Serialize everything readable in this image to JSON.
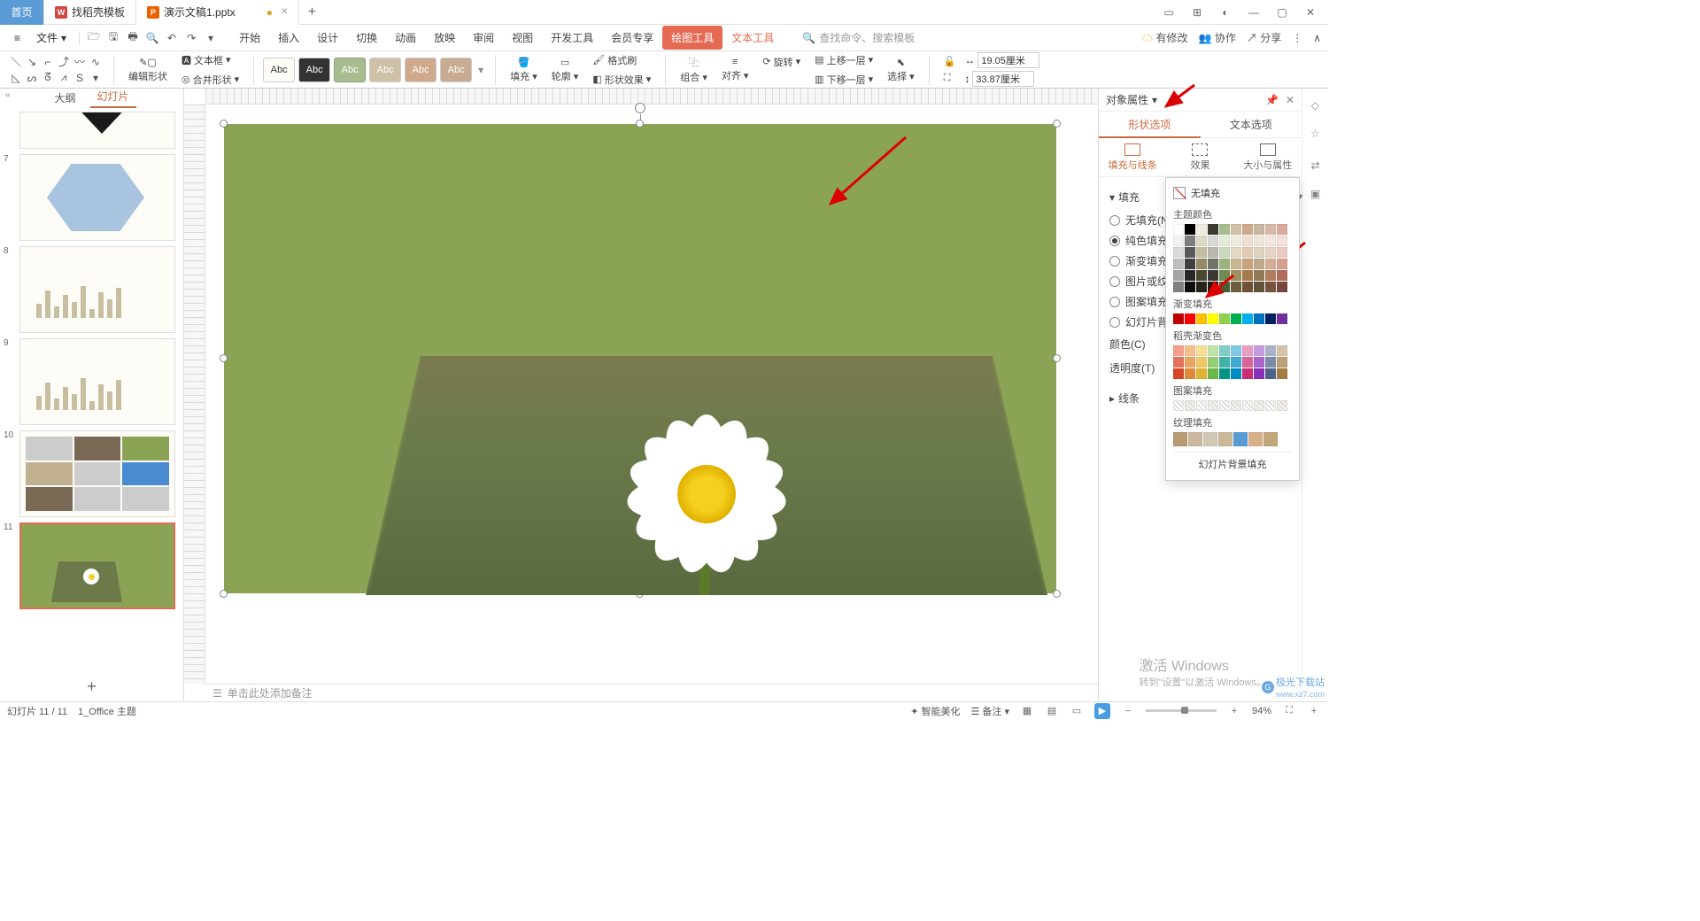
{
  "titlebar": {
    "home": "首页",
    "tab_template": "找稻壳模板",
    "tab_doc": "演示文稿1.pptx",
    "dirty_dot": "●",
    "plus": "+"
  },
  "menubar": {
    "file": "文件",
    "tabs": [
      "开始",
      "插入",
      "设计",
      "切换",
      "动画",
      "放映",
      "审阅",
      "视图",
      "开发工具",
      "会员专享"
    ],
    "draw_tool": "绘图工具",
    "text_tool": "文本工具",
    "search_placeholder": "查找命令、搜索模板",
    "pending": "有修改",
    "collab": "协作",
    "share": "分享"
  },
  "ribbon": {
    "edit_shape": "编辑形状",
    "textbox": "文本框",
    "merge_shape": "合并形状",
    "abc": "Abc",
    "fill": "填充",
    "outline": "轮廓",
    "shape_fx": "形状效果",
    "format_painter": "格式刷",
    "group": "组合",
    "align": "对齐",
    "rotate": "旋转",
    "bring_forward": "上移一层",
    "send_backward": "下移一层",
    "select": "选择",
    "width_icon": "↔",
    "height_icon": "↕",
    "width": "19.05厘米",
    "height": "33.87厘米"
  },
  "left": {
    "outline": "大纲",
    "slides": "幻灯片",
    "collapse": "«",
    "nums": [
      "7",
      "8",
      "9",
      "10",
      "11"
    ],
    "add": "+"
  },
  "canvas": {
    "notes_placeholder": "单击此处添加备注"
  },
  "panel": {
    "title": "对象属性",
    "shape_opts": "形状选项",
    "text_opts": "文本选项",
    "fill_line": "填充与线条",
    "effect": "效果",
    "size_prop": "大小与属性",
    "fill": "填充",
    "no_fill": "无填充(N)",
    "solid_fill": "纯色填充(S)",
    "gradient_fill": "渐变填充(G)",
    "pic_texture_fill": "图片或纹理填充(P)",
    "pattern_fill": "图案填充(A)",
    "slide_bg_fill": "幻灯片背景填充",
    "color": "颜色(C)",
    "opacity": "透明度(T)",
    "line": "线条"
  },
  "popup": {
    "no_fill": "无填充",
    "theme_colors": "主题颜色",
    "gradient_fill": "渐变填充",
    "dao_gradient": "稻壳渐变色",
    "pattern_fill": "图案填充",
    "texture_fill": "纹理填充",
    "slide_bg_fill": "幻灯片背景填充",
    "theme": {
      "row1": [
        "#ffffff",
        "#000000",
        "#efece1",
        "#3b3b34",
        "#a8bd8f",
        "#cfc1a8",
        "#d0a98c",
        "#c7b6a0",
        "#d6b9a8",
        "#dca9a0"
      ],
      "shades": [
        [
          "#f2f2f2",
          "#7f7f7f",
          "#ded9c5",
          "#d8d8d4",
          "#e5ebd9",
          "#f0ebdf",
          "#efe0d4",
          "#ece6da",
          "#f2e6df",
          "#f4e0dc"
        ],
        [
          "#d9d9d9",
          "#595959",
          "#c5bda0",
          "#b9b9b0",
          "#cdd9bc",
          "#e3d9c3",
          "#e1c9b2",
          "#dcd2bf",
          "#e7d2c4",
          "#ebcac2"
        ],
        [
          "#bfbfbf",
          "#404040",
          "#958c67",
          "#73736a",
          "#9ab57b",
          "#c7b690",
          "#caa37c",
          "#bdaa89",
          "#d3ae96",
          "#d59f91"
        ],
        [
          "#a6a6a6",
          "#262626",
          "#4b4630",
          "#3a3a33",
          "#6f8a52",
          "#a08f5f",
          "#a67a4f",
          "#8f7c57",
          "#b07d5e",
          "#b26e5c"
        ],
        [
          "#808080",
          "#0d0d0d",
          "#26231a",
          "#1d1d19",
          "#4a5d36",
          "#6b5f3f",
          "#6f5234",
          "#5f533a",
          "#76533e",
          "#77493d"
        ]
      ]
    },
    "bright": [
      "#c00000",
      "#ff0000",
      "#ffc000",
      "#ffff00",
      "#92d050",
      "#00b050",
      "#00b0f0",
      "#0070c0",
      "#002060",
      "#7030a0"
    ],
    "dao": {
      "row1": [
        "#f5a08c",
        "#f7bf8e",
        "#f7df95",
        "#bfe3a6",
        "#80cec7",
        "#80c8e6",
        "#e89ebf",
        "#c69be0",
        "#a9b3c7",
        "#d6c2a6"
      ],
      "row2": [
        "#e5735b",
        "#eaa562",
        "#ecc964",
        "#95ce77",
        "#40b1a6",
        "#40aad6",
        "#d9659b",
        "#a865ce",
        "#7c8ba9",
        "#bda073"
      ],
      "row3": [
        "#d64625",
        "#de8b36",
        "#e0b333",
        "#6cb948",
        "#009485",
        "#008cc5",
        "#cb2c77",
        "#8a2fbb",
        "#4f638c",
        "#a47e41"
      ]
    },
    "patterns": [
      "#ffffff",
      "#f6f3ea",
      "#ffffff",
      "#f6f3ea",
      "#ffffff",
      "#f6f3ea",
      "#ffffff",
      "#f6f3ea",
      "#ffffff",
      "#f6f3ea"
    ],
    "textures": [
      "#b99a72",
      "#c9b89d",
      "#d0c7b5",
      "#c9b997",
      "#5a9bd5",
      "#d6b089",
      "#c2a77b"
    ]
  },
  "statusbar": {
    "slide_pos": "幻灯片 11 / 11",
    "theme": "1_Office 主题",
    "beautify": "智能美化",
    "notes": "备注",
    "zoom": "94%"
  },
  "os": {
    "activate": "激活 Windows",
    "activate_sub": "转到\"设置\"以激活 Windows。",
    "watermark": "极光下载站",
    "watermark_url": "www.xz7.com"
  }
}
